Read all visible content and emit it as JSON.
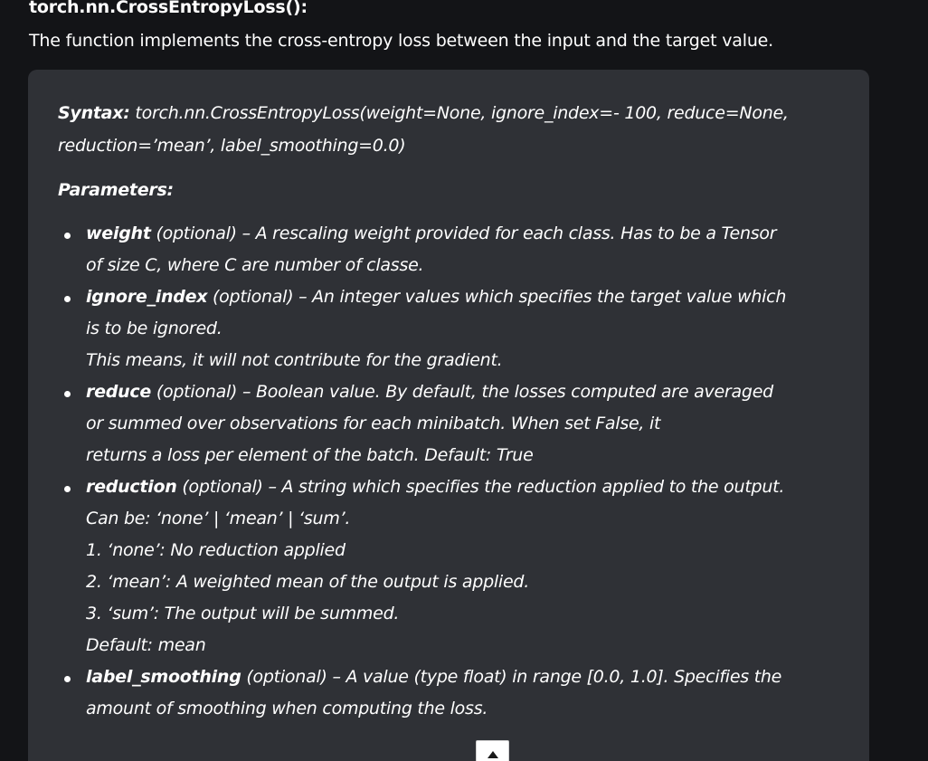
{
  "heading": "torch.nn.CrossEntropyLoss():",
  "intro": "The function implements the cross-entropy loss between the input and the target value.",
  "syntax": {
    "label": "Syntax:",
    "line1": " torch.nn.CrossEntropyLoss(weight=None, ignore_index=- 100, reduce=None,",
    "line2": "reduction=’mean’, label_smoothing=0.0)"
  },
  "parameters_label": "Parameters:",
  "parameters": [
    {
      "name": "weight",
      "lines": [
        " (optional) – A rescaling weight provided for each class. Has to be a Tensor",
        "of size C, where C are number of classe."
      ]
    },
    {
      "name": "ignore_index",
      "lines": [
        " (optional) – An integer values which specifies the target value which",
        "is to be ignored.",
        "This means, it will not contribute for the gradient."
      ]
    },
    {
      "name": "reduce",
      "lines": [
        " (optional) – Boolean value. By default, the losses computed are averaged",
        "or summed over observations for each minibatch. When set False, it",
        "returns a loss per element of the batch. Default: True"
      ]
    },
    {
      "name": "reduction",
      "lines": [
        " (optional) – A string which specifies the reduction applied to the output.",
        "Can be: ‘none’ | ‘mean’ | ‘sum’.",
        "1. ‘none’: No reduction applied",
        "2. ‘mean’: A weighted mean of the output is applied.",
        "3. ‘sum’: The output will be summed.",
        "Default: mean"
      ]
    },
    {
      "name": "label_smoothing",
      "lines": [
        " (optional) – A value (type float) in range [0.0, 1.0]. Specifies the",
        "amount of smoothing when computing the loss."
      ]
    }
  ],
  "scroll_top_icon": "caret-up-icon",
  "colors": {
    "page_background": "#131417",
    "card_background": "#2f3136",
    "text": "#ffffff"
  }
}
